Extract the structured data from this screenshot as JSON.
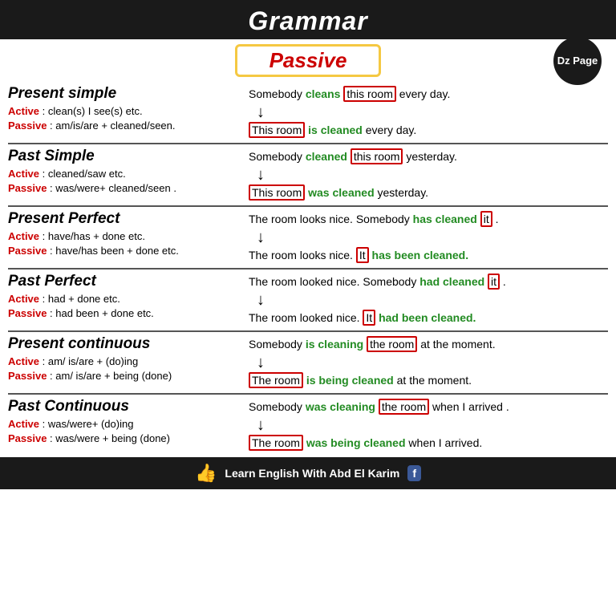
{
  "header": {
    "title": "Grammar",
    "passive_label": "Passive",
    "dz_page": "Dz Page"
  },
  "sections": [
    {
      "id": "present-simple",
      "title": "Present simple",
      "active_rule": "Active : clean(s) I see(s) etc.",
      "passive_rule": "Passive : am/is/are + cleaned/seen.",
      "example_active": "Somebody cleans this room every day.",
      "example_passive": "This room is cleaned every day.",
      "active_verb": "cleans",
      "passive_verb": "is cleaned",
      "active_box": "this room",
      "passive_box": "This room"
    },
    {
      "id": "past-simple",
      "title": "Past Simple",
      "active_rule": "Active : cleaned/saw etc.",
      "passive_rule": "Passive : was/were+ cleaned/seen .",
      "example_active": "Somebody cleaned this room yesterday.",
      "example_passive": "This room was cleaned yesterday.",
      "active_verb": "cleaned",
      "passive_verb": "was cleaned",
      "active_box": "this room",
      "passive_box": "This room"
    },
    {
      "id": "present-perfect",
      "title": "Present Perfect",
      "active_rule": "Active : have/has + done etc.",
      "passive_rule": "Passive : have/has been + done etc.",
      "example_active": "The room looks nice. Somebody has cleaned it .",
      "example_passive": "The room looks nice. It has been cleaned.",
      "active_verb": "has cleaned",
      "passive_verb": "has been cleaned",
      "active_box": "it",
      "passive_box": "It"
    },
    {
      "id": "past-perfect",
      "title": "Past Perfect",
      "active_rule": "Active : had + done etc.",
      "passive_rule": "Passive : had been + done etc.",
      "example_active": "The room looked nice. Somebody had cleaned it .",
      "example_passive": "The room looked nice. It had been cleaned.",
      "active_verb": "had cleaned",
      "passive_verb": "had been cleaned",
      "active_box": "it",
      "passive_box": "It"
    },
    {
      "id": "present-continuous",
      "title": "Present continuous",
      "active_rule": "Active : am/ is/are + (do)ing",
      "passive_rule": "Passive : am/ is/are + being (done)",
      "example_active": "Somebody is cleaning the room at the moment.",
      "example_passive": "The room is being cleaned at the moment.",
      "active_verb": "is cleaning",
      "passive_verb": "is being cleaned",
      "active_box": "the room",
      "passive_box": "The room"
    },
    {
      "id": "past-continuous",
      "title": "Past Continuous",
      "active_rule": "Active : was/were+ (do)ing",
      "passive_rule": "Passive : was/were + being (done)",
      "example_active": "Somebody was cleaning the room when I arrived .",
      "example_passive": "The room was being cleaned when I arrived.",
      "active_verb": "was cleaning",
      "passive_verb": "was being cleaned",
      "active_box": "the room",
      "passive_box": "The room"
    }
  ],
  "footer": {
    "text": "Learn English With Abd El Karim"
  }
}
